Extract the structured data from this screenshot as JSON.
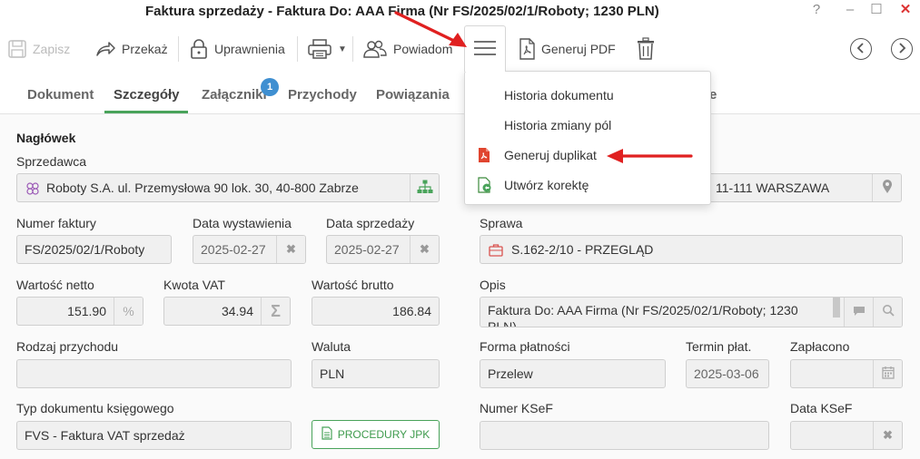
{
  "window": {
    "title": "Faktura sprzedaży - Faktura Do: AAA Firma (Nr FS/2025/02/1/Roboty; 1230 PLN)",
    "help": "?",
    "minimize": "–",
    "maximize": "☐",
    "close": "✕"
  },
  "toolbar": {
    "save": "Zapisz",
    "forward": "Przekaż",
    "permissions": "Uprawnienia",
    "notify": "Powiadom",
    "generate_pdf": "Generuj PDF"
  },
  "tabs": {
    "document": "Dokument",
    "details": "Szczegóły",
    "attachments": "Załączniki",
    "attachments_count": "1",
    "incomes": "Przychody",
    "relations": "Powiązania",
    "hidden_tail": "e"
  },
  "menu": {
    "history": "Historia dokumentu",
    "field_history": "Historia zmiany pól",
    "duplicate": "Generuj duplikat",
    "correction": "Utwórz korektę"
  },
  "form": {
    "section": "Nagłówek",
    "seller_label": "Sprzedawca",
    "seller_value": "Roboty S.A. ul. Przemysłowa 90 lok. 30, 40-800 Zabrze",
    "buyer_value": "11-111 WARSZAWA",
    "invoice_no_label": "Numer faktury",
    "invoice_no": "FS/2025/02/1/Roboty",
    "issue_date_label": "Data wystawienia",
    "issue_date": "2025-02-27",
    "sale_date_label": "Data sprzedaży",
    "sale_date": "2025-02-27",
    "case_label": "Sprawa",
    "case_value": "S.162-2/10 - PRZEGLĄD",
    "net_label": "Wartość netto",
    "net_value": "151.90",
    "percent": "%",
    "vat_label": "Kwota VAT",
    "vat_value": "34.94",
    "sigma": "Σ",
    "gross_label": "Wartość brutto",
    "gross_value": "186.84",
    "desc_label": "Opis",
    "desc_line1": "Faktura Do: AAA Firma  (Nr FS/2025/02/1/Roboty; 1230",
    "desc_line2": "PLN)",
    "income_type_label": "Rodzaj przychodu",
    "income_type_value": "",
    "currency_label": "Waluta",
    "currency_value": "PLN",
    "payment_label": "Forma płatności",
    "payment_value": "Przelew",
    "due_label": "Termin płat.",
    "due_value": "2025-03-06",
    "paid_label": "Zapłacono",
    "paid_value": "",
    "doc_type_label": "Typ dokumentu księgowego",
    "doc_type_value": "FVS - Faktura VAT sprzedaż",
    "jpk_button": "PROCEDURY JPK",
    "ksef_no_label": "Numer KSeF",
    "ksef_no_value": "",
    "ksef_date_label": "Data KSeF",
    "ksef_date_value": ""
  },
  "colors": {
    "accent": "#49a35a",
    "badge": "#3f8fd1",
    "annotation_arrow": "#e02020",
    "pdf_red": "#e0452f"
  }
}
